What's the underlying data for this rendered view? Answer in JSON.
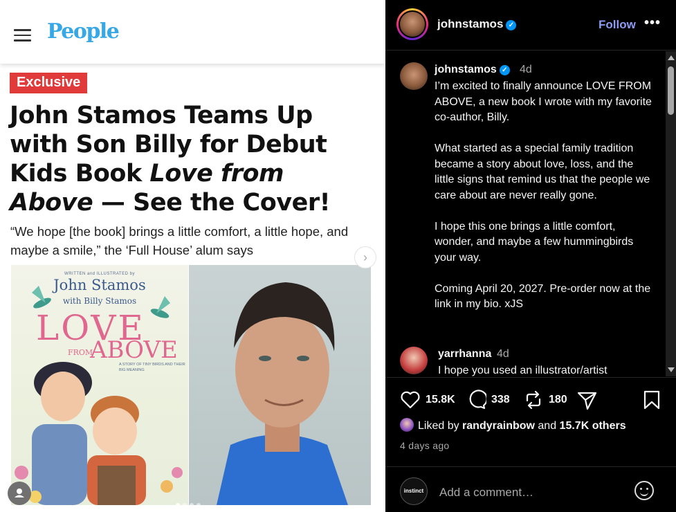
{
  "people": {
    "logo": "People",
    "badge": "Exclusive",
    "headline_part1": "John Stamos Teams Up with Son Billy for Debut Kids Book ",
    "headline_italic": "Love from Above",
    "headline_part2": " — See the Cover!",
    "dek": "“We hope [the book] brings a little comfort, a little hope, and maybe a smile,” the ‘Full House’ alum says",
    "book_cover": {
      "written_by": "WRITTEN and ILLUSTRATED by",
      "author": "John Stamos",
      "with": "with Billy Stamos",
      "title_love": "LOVE",
      "title_from": "FROM",
      "title_above": "ABOVE",
      "subtitle": "A STORY OF TINY BIRDS AND THEIR BIG MEANING"
    },
    "gallery_next": "›",
    "gallery_dots": 4
  },
  "instagram": {
    "header_user": "johnstamos",
    "follow": "Follow",
    "more": "•••",
    "caption_user": "johnstamos",
    "caption_time": "4d",
    "caption_paragraphs": [
      "I’m excited to finally announce LOVE FROM ABOVE, a new book I wrote with my favorite co-author, Billy.",
      "What started as a special family tradition became a story about love, loss, and the little signs that remind us that the people we care about are never really gone.",
      "I hope this one brings a little comfort, wonder, and maybe a few hummingbirds your way.",
      "Coming April 20, 2027. Pre-order now at the link in my bio. xJS"
    ],
    "comment_user": "yarrhanna",
    "comment_time": "4d",
    "comment_text": "I hope you used an illustrator/artist",
    "likes": "15.8K",
    "comments": "338",
    "reposts": "180",
    "liked_by_prefix": "Liked by ",
    "liked_by_user": "randyrainbow",
    "liked_by_and": " and ",
    "liked_by_others": "15.7K others",
    "post_time": "4 days ago",
    "commenter_badge": "instinct",
    "comment_placeholder": "Add a comment…"
  }
}
